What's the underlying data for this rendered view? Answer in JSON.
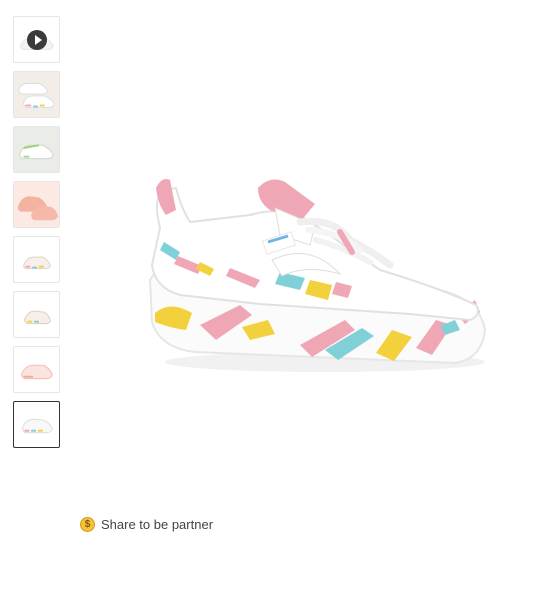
{
  "top_strip": {
    "left_text": "",
    "right_text": ""
  },
  "gallery": {
    "thumbnails": [
      {
        "name": "video-thumbnail",
        "selected": false,
        "icon": "play-icon"
      },
      {
        "name": "thumbnail-2",
        "selected": false
      },
      {
        "name": "thumbnail-3",
        "selected": false
      },
      {
        "name": "thumbnail-4",
        "selected": false
      },
      {
        "name": "thumbnail-5",
        "selected": false
      },
      {
        "name": "thumbnail-6",
        "selected": false
      },
      {
        "name": "thumbnail-7",
        "selected": false
      },
      {
        "name": "thumbnail-8",
        "selected": true
      }
    ]
  },
  "share": {
    "icon": "coin-icon",
    "coin_symbol": "$",
    "label": "Share to be partner"
  },
  "colors": {
    "selected_border": "#333333",
    "thumb_border": "#e6e6e6",
    "coin": "#f4c13d",
    "paint_pink": "#f0a7b5",
    "paint_blue": "#7fd0d7",
    "paint_yellow": "#f2d13c"
  }
}
